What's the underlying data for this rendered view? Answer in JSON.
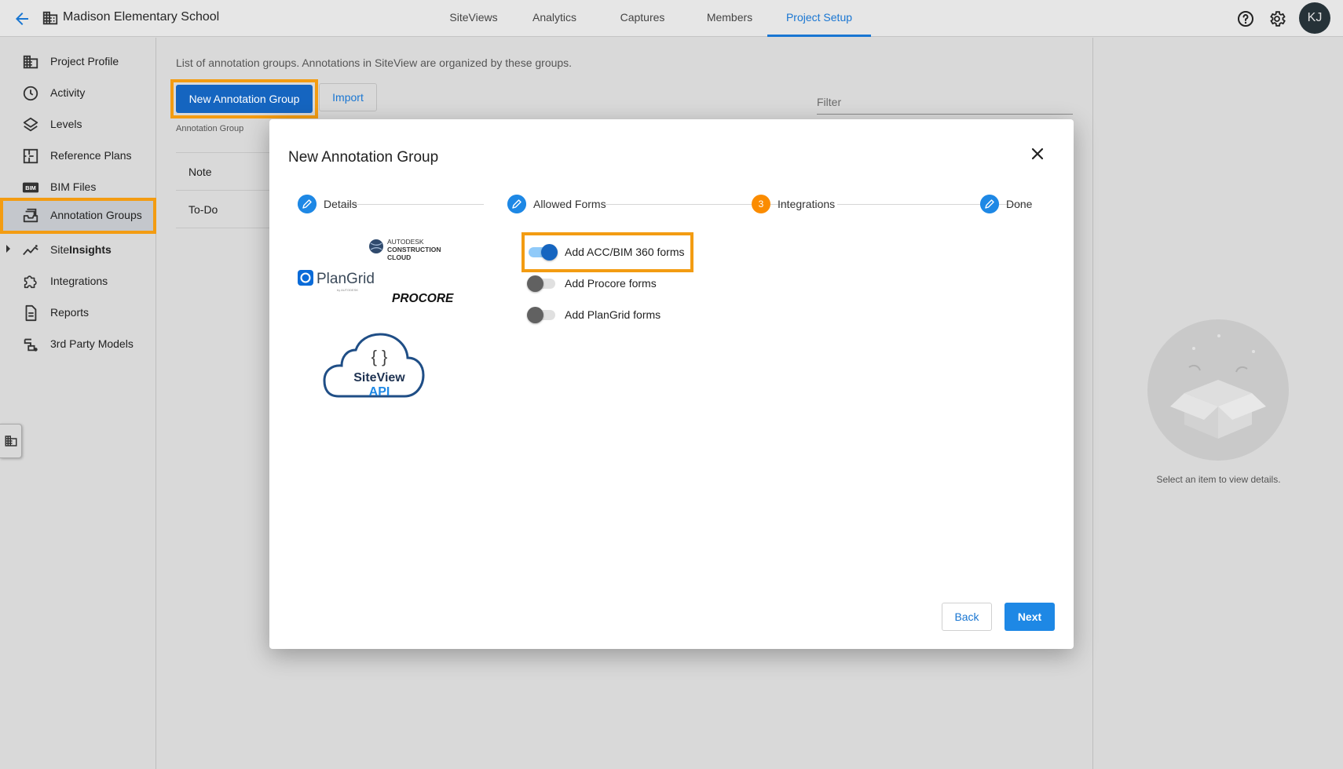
{
  "header": {
    "project_title": "Madison Elementary School",
    "tabs": [
      {
        "label": "SiteViews"
      },
      {
        "label": "Analytics"
      },
      {
        "label": "Captures"
      },
      {
        "label": "Members"
      },
      {
        "label": "Project Setup",
        "active": true
      }
    ],
    "avatar_initials": "KJ"
  },
  "sidebar": {
    "items": [
      {
        "label": "Project Profile",
        "icon": "building-icon"
      },
      {
        "label": "Activity",
        "icon": "clock-icon"
      },
      {
        "label": "Levels",
        "icon": "layers-icon"
      },
      {
        "label": "Reference Plans",
        "icon": "floorplan-icon"
      },
      {
        "label": "BIM Files",
        "icon": "bim-icon"
      },
      {
        "label": "Annotation Groups",
        "icon": "inbox-icon",
        "selected": true
      },
      {
        "label_regular": "Site",
        "label_bold": "Insights",
        "icon": "trend-icon"
      },
      {
        "label": "Integrations",
        "icon": "puzzle-icon"
      },
      {
        "label": "Reports",
        "icon": "document-icon"
      },
      {
        "label": "3rd Party Models",
        "icon": "models-icon"
      }
    ],
    "bim_badge": "BIM"
  },
  "main": {
    "description": "List of annotation groups. Annotations in SiteView are organized by these groups.",
    "new_button": "New Annotation Group",
    "import_button": "Import",
    "filter_placeholder": "Filter",
    "table_header": "Annotation Group",
    "rows": [
      "Note",
      "To-Do"
    ]
  },
  "details": {
    "empty_message": "Select an item to view details."
  },
  "modal": {
    "title": "New Annotation Group",
    "steps": [
      {
        "label": "Details",
        "state": "edit"
      },
      {
        "label": "Allowed Forms",
        "state": "edit"
      },
      {
        "label": "Integrations",
        "state": "active",
        "number": "3"
      },
      {
        "label": "Done",
        "state": "edit"
      }
    ],
    "logos": {
      "autodesk_line1": "AUTODESK",
      "autodesk_line2": "CONSTRUCTION",
      "autodesk_line3": "CLOUD",
      "plangrid": "PlanGrid",
      "plangrid_sub": "by AUTODESK",
      "procore": "PROCORE",
      "api_braces": "{ }",
      "api_line1": "SiteView",
      "api_line2": "API"
    },
    "toggles": [
      {
        "label": "Add ACC/BIM 360 forms",
        "on": true
      },
      {
        "label": "Add Procore forms",
        "on": false
      },
      {
        "label": "Add PlanGrid forms",
        "on": false
      }
    ],
    "back_button": "Back",
    "next_button": "Next"
  },
  "colors": {
    "accent": "#1976d2",
    "primary_button": "#1565c0",
    "highlight": "#f39c12",
    "step_active": "#fb8c00"
  }
}
